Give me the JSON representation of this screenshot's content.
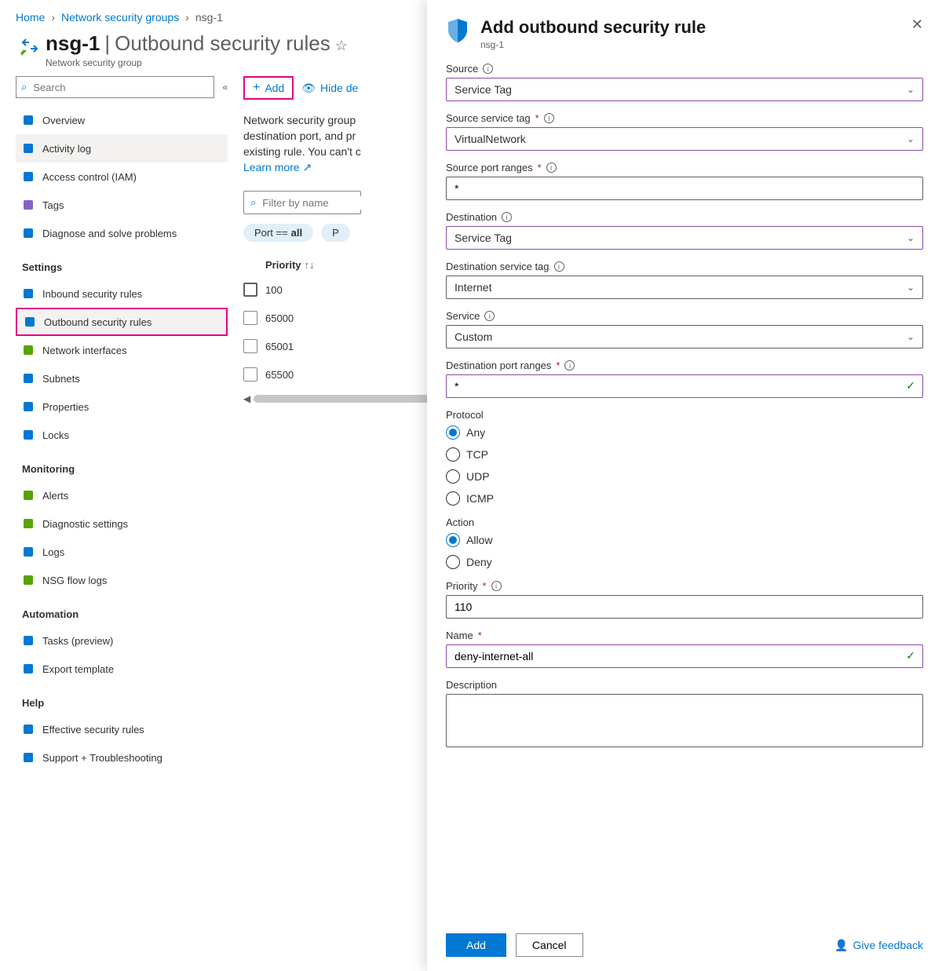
{
  "breadcrumb": {
    "home": "Home",
    "parent": "Network security groups",
    "current": "nsg-1"
  },
  "header": {
    "title": "nsg-1",
    "separator": "|",
    "subsection": "Outbound security rules",
    "subtitle": "Network security group"
  },
  "sidebar": {
    "search_placeholder": "Search",
    "base": [
      {
        "label": "Overview",
        "icon": "shield",
        "color": "#0078d4"
      },
      {
        "label": "Activity log",
        "icon": "doc",
        "color": "#0078d4",
        "active": true
      },
      {
        "label": "Access control (IAM)",
        "icon": "people",
        "color": "#0078d4"
      },
      {
        "label": "Tags",
        "icon": "tag",
        "color": "#8661c5"
      },
      {
        "label": "Diagnose and solve problems",
        "icon": "wrench",
        "color": "#0078d4"
      }
    ],
    "settings_label": "Settings",
    "settings": [
      {
        "label": "Inbound security rules",
        "icon": "inbound",
        "color": "#0078d4"
      },
      {
        "label": "Outbound security rules",
        "icon": "outbound",
        "color": "#0078d4",
        "highlighted": true
      },
      {
        "label": "Network interfaces",
        "icon": "nic",
        "color": "#57a300"
      },
      {
        "label": "Subnets",
        "icon": "subnet",
        "color": "#0078d4"
      },
      {
        "label": "Properties",
        "icon": "props",
        "color": "#0078d4"
      },
      {
        "label": "Locks",
        "icon": "lock",
        "color": "#0078d4"
      }
    ],
    "monitoring_label": "Monitoring",
    "monitoring": [
      {
        "label": "Alerts",
        "icon": "alert",
        "color": "#57a300"
      },
      {
        "label": "Diagnostic settings",
        "icon": "diag",
        "color": "#57a300"
      },
      {
        "label": "Logs",
        "icon": "logs",
        "color": "#0078d4"
      },
      {
        "label": "NSG flow logs",
        "icon": "flow",
        "color": "#57a300"
      }
    ],
    "automation_label": "Automation",
    "automation": [
      {
        "label": "Tasks (preview)",
        "icon": "tasks",
        "color": "#0078d4"
      },
      {
        "label": "Export template",
        "icon": "export",
        "color": "#0078d4"
      }
    ],
    "help_label": "Help",
    "help": [
      {
        "label": "Effective security rules",
        "icon": "eff",
        "color": "#0078d4"
      },
      {
        "label": "Support + Troubleshooting",
        "icon": "support",
        "color": "#0078d4"
      }
    ]
  },
  "toolbar": {
    "add": "Add",
    "hide": "Hide de"
  },
  "main_desc": {
    "l1": "Network security group",
    "l2": "destination port, and pr",
    "l3": "existing rule. You can't c",
    "learn": "Learn more"
  },
  "filters": {
    "placeholder": "Filter by name",
    "pill1_prefix": "Port == ",
    "pill1_value": "all",
    "pill2": "P"
  },
  "table": {
    "head_priority": "Priority",
    "rows": [
      {
        "priority": "100",
        "first": true
      },
      {
        "priority": "65000"
      },
      {
        "priority": "65001"
      },
      {
        "priority": "65500"
      }
    ]
  },
  "panel": {
    "title": "Add outbound security rule",
    "subtitle": "nsg-1",
    "source_label": "Source",
    "source_value": "Service Tag",
    "source_tag_label": "Source service tag",
    "source_tag_value": "VirtualNetwork",
    "source_ports_label": "Source port ranges",
    "source_ports_value": "*",
    "dest_label": "Destination",
    "dest_value": "Service Tag",
    "dest_tag_label": "Destination service tag",
    "dest_tag_value": "Internet",
    "service_label": "Service",
    "service_value": "Custom",
    "dest_ports_label": "Destination port ranges",
    "dest_ports_value": "*",
    "protocol_label": "Protocol",
    "protocol_options": [
      "Any",
      "TCP",
      "UDP",
      "ICMP"
    ],
    "protocol_selected": "Any",
    "action_label": "Action",
    "action_options": [
      "Allow",
      "Deny"
    ],
    "action_selected": "Allow",
    "priority_label": "Priority",
    "priority_value": "110",
    "name_label": "Name",
    "name_value": "deny-internet-all",
    "description_label": "Description",
    "add_btn": "Add",
    "cancel_btn": "Cancel",
    "feedback": "Give feedback"
  }
}
